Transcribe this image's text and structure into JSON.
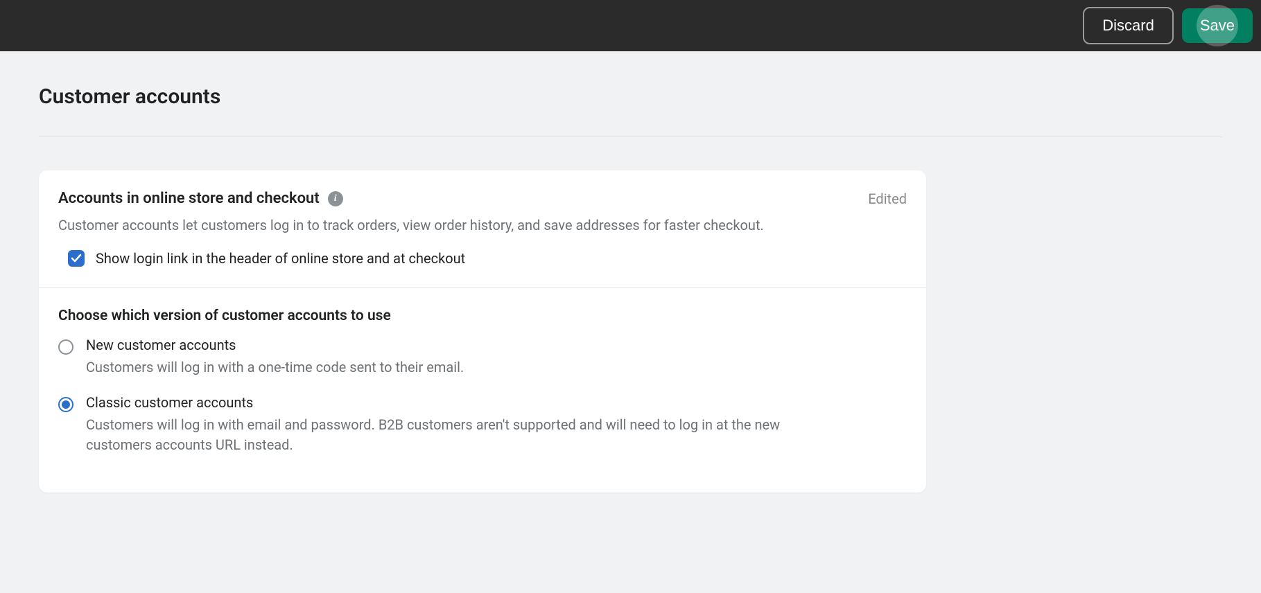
{
  "topbar": {
    "discard_label": "Discard",
    "save_label": "Save"
  },
  "page": {
    "title": "Customer accounts"
  },
  "section1": {
    "title": "Accounts in online store and checkout",
    "edited": "Edited",
    "description": "Customer accounts let customers log in to track orders, view order history, and save addresses for faster checkout.",
    "checkbox_label": "Show login link in the header of online store and at checkout",
    "checkbox_checked": true
  },
  "section2": {
    "title": "Choose which version of customer accounts to use",
    "options": [
      {
        "label": "New customer accounts",
        "description": "Customers will log in with a one-time code sent to their email.",
        "selected": false
      },
      {
        "label": "Classic customer accounts",
        "description": "Customers will log in with email and password. B2B customers aren't supported and will need to log in at the new customers accounts URL instead.",
        "selected": true
      }
    ]
  }
}
